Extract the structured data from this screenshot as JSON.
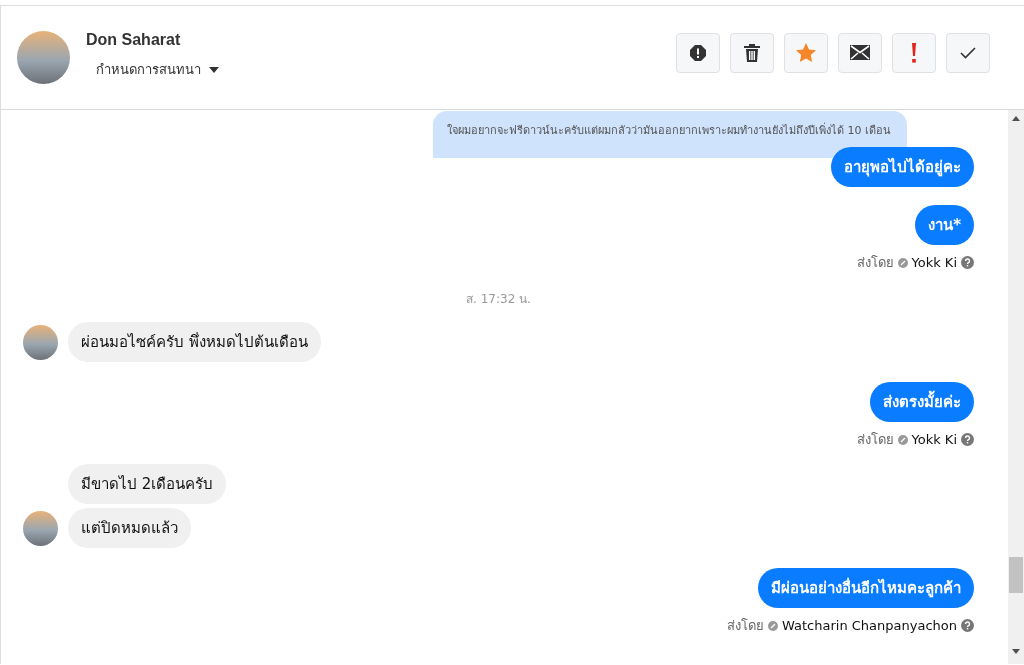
{
  "header": {
    "name": "Don Saharat",
    "menu_label": "กำหนดการสนทนา",
    "actions": [
      {
        "kind": "spam"
      },
      {
        "kind": "delete"
      },
      {
        "kind": "star"
      },
      {
        "kind": "unread"
      },
      {
        "kind": "important"
      },
      {
        "kind": "done"
      }
    ]
  },
  "messages": [
    {
      "kind": "quote",
      "text": "ใจผมอยากจะฟรีดาวน์นะครับแต่ผมกลัวว่ามันออกยากเพราะผมทำงานยังไม่ถึงปีเพิ่งได้ 10 เดือน"
    },
    {
      "kind": "outgoing",
      "text": "อายุพอไปได้อยู่คะ"
    },
    {
      "kind": "outgoing",
      "text": "งาน*"
    },
    {
      "kind": "sender",
      "prefix": "ส่งโดย",
      "name": "Yokk Ki"
    },
    {
      "kind": "time",
      "text": "ส. 17:32 น."
    },
    {
      "kind": "incoming",
      "text": "ผ่อนมอไซค์ครับ พึ่งหมดไปต้นเดือน",
      "avatar": true
    },
    {
      "kind": "outgoing",
      "text": "ส่งตรงมั้ยค่ะ"
    },
    {
      "kind": "sender",
      "prefix": "ส่งโดย",
      "name": "Yokk Ki"
    },
    {
      "kind": "incoming",
      "text": "มีขาดไป 2เดือนครับ",
      "avatar": false
    },
    {
      "kind": "incoming",
      "text": "แต่ปิดหมดแล้ว",
      "avatar": true
    },
    {
      "kind": "outgoing",
      "text": "มีผ่อนอย่างอื่นอีกไหมคะลูกค้า"
    },
    {
      "kind": "sender",
      "prefix": "ส่งโดย",
      "name": "Watcharin Chanpanyachon"
    }
  ]
}
